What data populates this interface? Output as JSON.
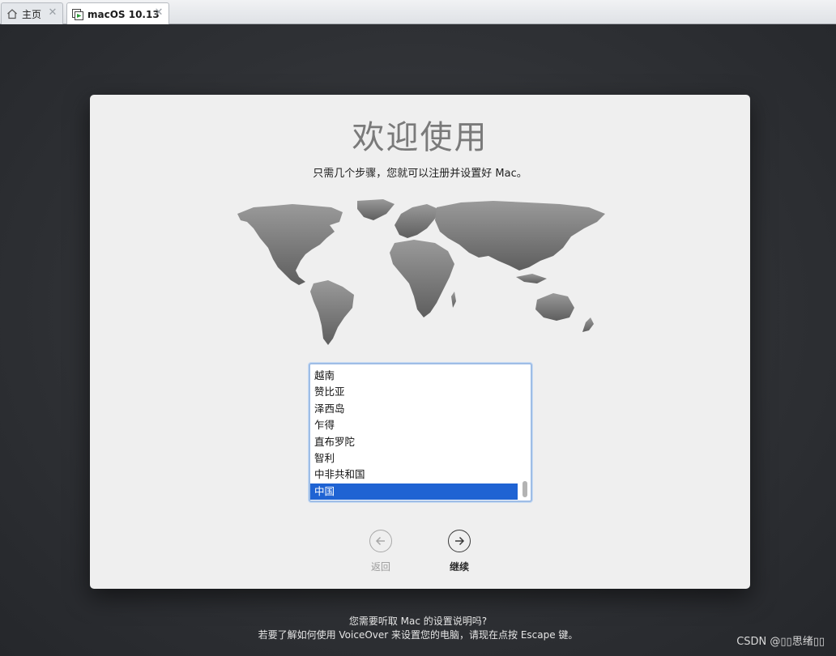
{
  "tabs": [
    {
      "label": "主页",
      "icon": "home-icon",
      "active": false
    },
    {
      "label": "macOS 10.13",
      "icon": "vm-icon",
      "active": true
    }
  ],
  "window": {
    "title": "欢迎使用",
    "subtitle": "只需几个步骤，您就可以注册并设置好 Mac。"
  },
  "country_list": {
    "items": [
      "越南",
      "赞比亚",
      "泽西岛",
      "乍得",
      "直布罗陀",
      "智利",
      "中非共和国",
      "中国"
    ],
    "selected": "中国"
  },
  "nav": {
    "back_label": "返回",
    "continue_label": "继续"
  },
  "voiceover": {
    "line1": "您需要听取 Mac 的设置说明吗?",
    "line2": "若要了解如何使用 VoiceOver 来设置您的电脑，请现在点按 Escape 键。"
  },
  "watermark": "CSDN @▯▯思绪▯▯",
  "colors": {
    "selection": "#1f63d3",
    "list_border": "#9ebde6",
    "window_bg": "#efefef",
    "desktop_bg": "#2f3135"
  }
}
